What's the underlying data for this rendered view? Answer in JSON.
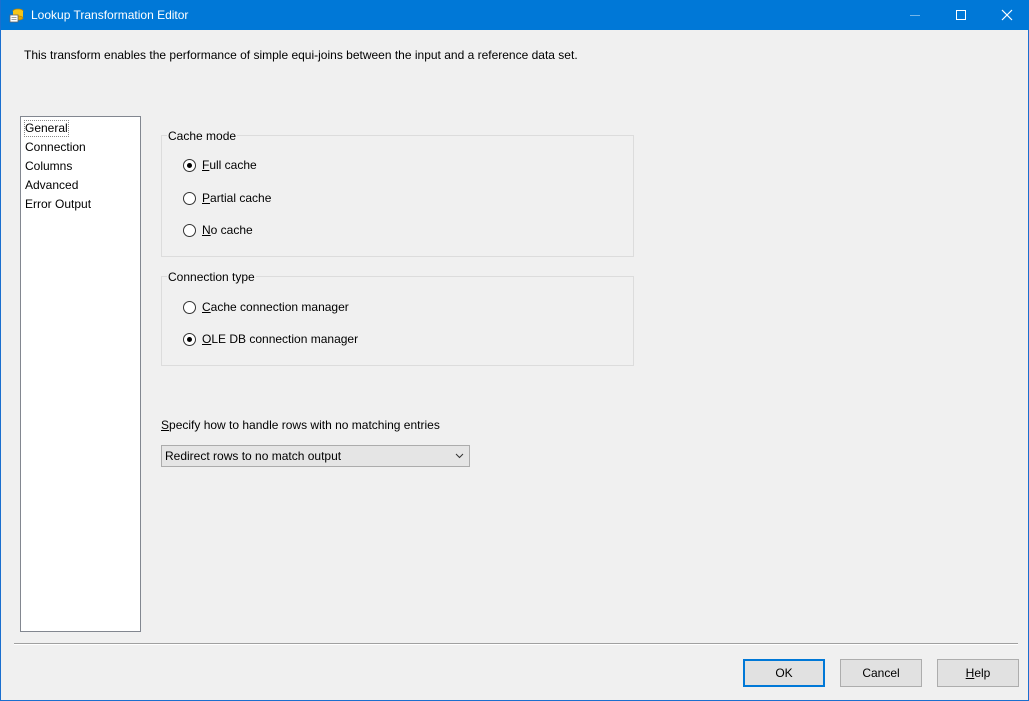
{
  "window": {
    "title": "Lookup Transformation Editor",
    "accent_color": "#0078d7"
  },
  "description": "This transform enables the performance of simple equi-joins between the input and a reference data set.",
  "nav": {
    "items": [
      {
        "label": "General",
        "selected": true
      },
      {
        "label": "Connection",
        "selected": false
      },
      {
        "label": "Columns",
        "selected": false
      },
      {
        "label": "Advanced",
        "selected": false
      },
      {
        "label": "Error Output",
        "selected": false
      }
    ]
  },
  "cache_mode": {
    "label": "Cache mode",
    "options": [
      {
        "accel": "F",
        "rest": "ull cache",
        "checked": true
      },
      {
        "accel": "P",
        "rest": "artial cache",
        "checked": false
      },
      {
        "accel": "N",
        "rest": "o cache",
        "checked": false
      }
    ]
  },
  "connection_type": {
    "label": "Connection type",
    "options": [
      {
        "accel": "C",
        "rest": "ache connection manager",
        "checked": false
      },
      {
        "accel": "O",
        "rest": "LE DB connection manager",
        "checked": true
      }
    ]
  },
  "no_match": {
    "label_accel": "S",
    "label_rest": "pecify how to handle rows with no matching entries",
    "selected_value": "Redirect rows to no match output"
  },
  "buttons": {
    "ok": "OK",
    "cancel": "Cancel",
    "help_accel": "H",
    "help_rest": "elp"
  }
}
